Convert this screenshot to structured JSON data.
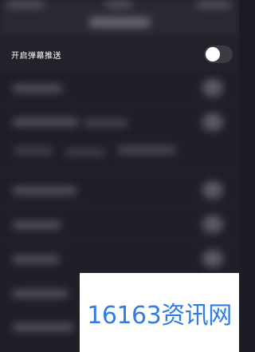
{
  "danmaku_push": {
    "label": "开启弹幕推送",
    "enabled": false
  },
  "watermark": {
    "text": "16163资讯网",
    "color": "#2f7de2"
  },
  "colors": {
    "background": "#1f1f28",
    "row_background": "#22222b",
    "toggle_off": "#3b3b44",
    "toggle_knob": "#ffffff",
    "label_text": "#ffffff"
  }
}
